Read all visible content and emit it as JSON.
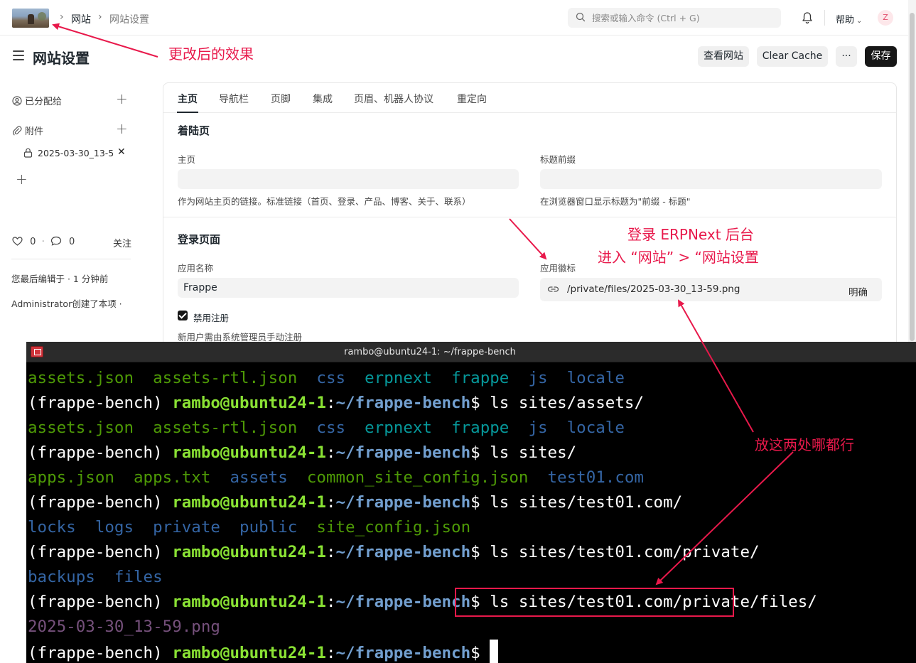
{
  "nav": {
    "breadcrumb": [
      "网站",
      "网站设置"
    ],
    "search_placeholder": "搜索或输入命令 (Ctrl + G)",
    "help_label": "帮助",
    "avatar_letter": "Z"
  },
  "header": {
    "title": "网站设置",
    "buttons": {
      "view_site": "查看网站",
      "clear_cache": "Clear Cache",
      "more": "···",
      "save": "保存"
    }
  },
  "sidebar": {
    "assigned_label": "已分配给",
    "attachments_label": "附件",
    "attachment_file": "2025-03-30_13-59.png",
    "likes": "0",
    "comments": "0",
    "follow_label": "关注",
    "last_edit": "您最后编辑于 · 1 分钟前",
    "created": "Administrator创建了本项 ·"
  },
  "tabs": [
    "主页",
    "导航栏",
    "页脚",
    "集成",
    "页眉、机器人协议",
    "重定向"
  ],
  "landing": {
    "title": "着陆页",
    "home_label": "主页",
    "home_value": "",
    "home_desc": "作为网站主页的链接。标准链接（首页、登录、产品、博客、关于、联系）",
    "prefix_label": "标题前缀",
    "prefix_value": "",
    "prefix_desc": "在浏览器窗口显示标题为\"前缀 - 标题\""
  },
  "login": {
    "title": "登录页面",
    "app_name_label": "应用名称",
    "app_name_value": "Frappe",
    "app_logo_label": "应用徽标",
    "app_logo_value": "/private/files/2025-03-30_13-59.png",
    "clear_label": "明确",
    "disable_signup_label": "禁用注册",
    "disable_signup_desc": "新用户需由系统管理员手动注册"
  },
  "terminal": {
    "title": "rambo@ubuntu24-1: ~/frappe-bench",
    "env": "(frappe-bench)",
    "user_host": "rambo@ubuntu24-1",
    "cwd": "~/frappe-bench",
    "lines": [
      {
        "type": "listing",
        "items": [
          {
            "text": "assets.json",
            "color": "green"
          },
          {
            "text": "assets-rtl.json",
            "color": "green"
          },
          {
            "text": "css",
            "color": "blue"
          },
          {
            "text": "erpnext",
            "color": "cyan"
          },
          {
            "text": "frappe",
            "color": "cyan"
          },
          {
            "text": "js",
            "color": "blue"
          },
          {
            "text": "locale",
            "color": "blue"
          }
        ]
      },
      {
        "type": "prompt",
        "cmd": "ls sites/assets/"
      },
      {
        "type": "listing",
        "items": [
          {
            "text": "assets.json",
            "color": "green"
          },
          {
            "text": "assets-rtl.json",
            "color": "green"
          },
          {
            "text": "css",
            "color": "blue"
          },
          {
            "text": "erpnext",
            "color": "cyan"
          },
          {
            "text": "frappe",
            "color": "cyan"
          },
          {
            "text": "js",
            "color": "blue"
          },
          {
            "text": "locale",
            "color": "blue"
          }
        ]
      },
      {
        "type": "prompt",
        "cmd": "ls sites/"
      },
      {
        "type": "listing",
        "items": [
          {
            "text": "apps.json",
            "color": "green"
          },
          {
            "text": "apps.txt",
            "color": "green"
          },
          {
            "text": "assets",
            "color": "blue"
          },
          {
            "text": "common_site_config.json",
            "color": "green"
          },
          {
            "text": "test01.com",
            "color": "blue"
          }
        ]
      },
      {
        "type": "prompt",
        "cmd": "ls sites/test01.com/"
      },
      {
        "type": "listing",
        "items": [
          {
            "text": "locks",
            "color": "blue"
          },
          {
            "text": "logs",
            "color": "blue"
          },
          {
            "text": "private",
            "color": "blue"
          },
          {
            "text": "public",
            "color": "blue"
          },
          {
            "text": "site_config.json",
            "color": "green"
          }
        ]
      },
      {
        "type": "prompt",
        "cmd": "ls sites/test01.com/private/"
      },
      {
        "type": "listing",
        "items": [
          {
            "text": "backups",
            "color": "blue"
          },
          {
            "text": "files",
            "color": "blue"
          }
        ]
      },
      {
        "type": "prompt",
        "cmd": "ls sites/test01.com/private/files/"
      },
      {
        "type": "listing",
        "items": [
          {
            "text": "2025-03-30_13-59.png",
            "color": "purple"
          }
        ]
      },
      {
        "type": "prompt",
        "cmd": "",
        "cursor": true
      }
    ]
  },
  "annotations": {
    "after_change": "更改后的效果",
    "login_erpnext": "登录 ERPNext 后台",
    "enter_site": "进入 “网站” > “网站设置",
    "either_place": "放这两处哪都行",
    "accent_color": "#e8194b"
  }
}
